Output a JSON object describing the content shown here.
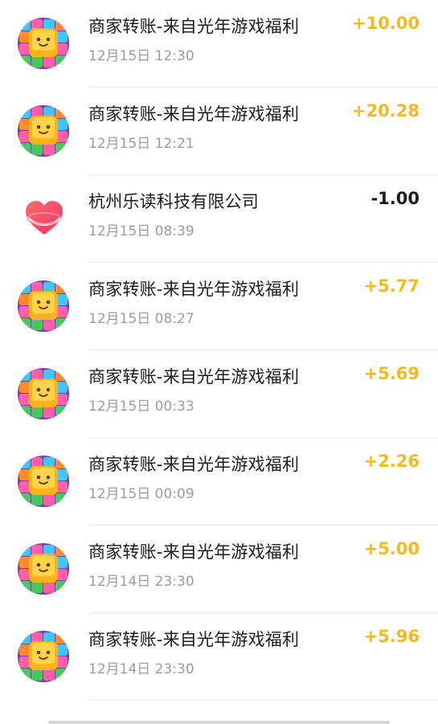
{
  "colors": {
    "income": "#f5b81e",
    "expense": "#1c1c1c",
    "secondary_text": "#9b9b9b"
  },
  "transactions": [
    {
      "icon": "game-app-icon",
      "title": "商家转账-来自光年游戏福利",
      "time": "12月15日 12:30",
      "amount": "+10.00",
      "direction": "in"
    },
    {
      "icon": "game-app-icon",
      "title": "商家转账-来自光年游戏福利",
      "time": "12月15日 12:21",
      "amount": "+20.28",
      "direction": "in"
    },
    {
      "icon": "heart-logo-icon",
      "title": "杭州乐读科技有限公司",
      "time": "12月15日 08:39",
      "amount": "-1.00",
      "direction": "out"
    },
    {
      "icon": "game-app-icon",
      "title": "商家转账-来自光年游戏福利",
      "time": "12月15日 08:27",
      "amount": "+5.77",
      "direction": "in"
    },
    {
      "icon": "game-app-icon",
      "title": "商家转账-来自光年游戏福利",
      "time": "12月15日 00:33",
      "amount": "+5.69",
      "direction": "in"
    },
    {
      "icon": "game-app-icon",
      "title": "商家转账-来自光年游戏福利",
      "time": "12月15日 00:09",
      "amount": "+2.26",
      "direction": "in"
    },
    {
      "icon": "game-app-icon",
      "title": "商家转账-来自光年游戏福利",
      "time": "12月14日 23:30",
      "amount": "+5.00",
      "direction": "in"
    },
    {
      "icon": "game-app-icon",
      "title": "商家转账-来自光年游戏福利",
      "time": "12月14日 23:30",
      "amount": "+5.96",
      "direction": "in"
    }
  ]
}
